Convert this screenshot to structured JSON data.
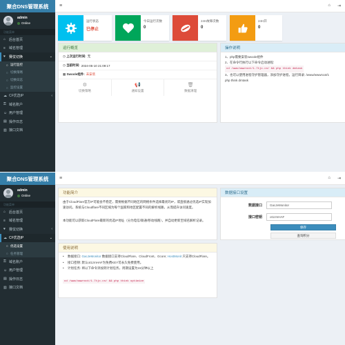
{
  "app": {
    "brand": "聚合DNS管理系统",
    "user": "admin",
    "status": "Online",
    "nav_header": "功能菜单"
  },
  "colors": {
    "sidebar": "#222d32",
    "brand": "#367fa9",
    "cyan": "#00c0ef",
    "green": "#00a65a",
    "red": "#dd4b39",
    "orange": "#f39c12"
  },
  "s1": {
    "menu": [
      {
        "label": "后台首页",
        "icon": "home-icon"
      },
      {
        "label": "域名管理",
        "icon": "list-icon"
      }
    ],
    "open_menu": "赛仗切换",
    "open_icon": "heart-icon",
    "sub": [
      "运行监控",
      "切换策略",
      "切换日志",
      "监控设置"
    ],
    "menu2": [
      {
        "label": "CF优选IP",
        "icon": "cloud-icon",
        "arrow": "‹"
      },
      {
        "label": "域名账户",
        "icon": "lock-icon"
      },
      {
        "label": "用户管理",
        "icon": "user-icon"
      },
      {
        "label": "操作日志",
        "icon": "file-icon"
      },
      {
        "label": "接口文档",
        "icon": "book-icon"
      }
    ],
    "cards": [
      {
        "title": "运行状态",
        "value": "已停止"
      },
      {
        "title": "今日运行次数",
        "value": "0"
      },
      {
        "title": "24H故障次数",
        "value": "0"
      },
      {
        "title": "24H开",
        "value": "0"
      }
    ],
    "overview": {
      "title": "运行概览",
      "last_run_label": "上次运行时间:",
      "last_run_value": "无",
      "now_label": "当前时间:",
      "now_value": "2024-05-10 21:09:17",
      "swoole_label": "Swoole组件:",
      "swoole_value": "未安装",
      "actions": [
        "切换策略",
        "通知设置",
        "数据清理"
      ]
    },
    "guide": {
      "title": "操作说明",
      "l1": "1、php需要安装swoole组件",
      "l2": "2、在命令行执行以下命令启动进程:",
      "cmd": "cd /www/wwwroot/1.7tjc.cn/ && php think dmtask",
      "l3": "3、也可以使用进程守护管理器，添加守护进程，运行目录: /www/wwwroot/1",
      "l4": "php think dmtask"
    }
  },
  "s2": {
    "menu": [
      {
        "label": "后台首页",
        "icon": "home-icon"
      },
      {
        "label": "域名管理",
        "icon": "list-icon"
      },
      {
        "label": "赛仗切换",
        "icon": "heart-icon",
        "arrow": "‹"
      }
    ],
    "open_menu": "CF优选IP",
    "open_icon": "cloud-icon",
    "sub": [
      "优选设置",
      "任务管理"
    ],
    "menu2": [
      {
        "label": "域名账户",
        "icon": "lock-icon"
      },
      {
        "label": "用户管理",
        "icon": "user-icon"
      },
      {
        "label": "操作日志",
        "icon": "file-icon"
      },
      {
        "label": "接口文档",
        "icon": "book-icon"
      }
    ],
    "intro": {
      "title": "功能简介",
      "p1": "由于CloudFlare官方IP可能会不稳定，需要根据不同地区的网络条件选择最优的IP，或直接通过优选IP实现加速访问。系统与Cloudflare不同区域为每个国家和地区配置不同的解析线路，从而提升访问速度。",
      "p2": "本功能可以获取CloudFlare最新的优选IP地址（分为电信/联通/移动线路），并自动更新至域名解析记录。"
    },
    "usage": {
      "title": "使用说明",
      "b1a": "数据接口: ",
      "b1b": "GacJeMonitor",
      "b1c": " 数据接口支持CloudFlare、CloudFront、Gcore; ",
      "b1d": "HostMonit",
      "b1e": " 只支持CloudFlare。",
      "b2": "接口密钥: 默认ot1zmHAF为免费KEY可永久免费使用。",
      "b3": "计划任务: 将以下命令添加到计划任务，周期设置为15分钟以上",
      "cmd": "cd /www/wwwroot/1.7tjc.cn/ && php think optimize"
    },
    "settings": {
      "title": "数据接口设置",
      "api_label": "数据接口",
      "api_value": "GacJeMonitor",
      "key_label": "接口密钥",
      "key_value": "ot1zmHAF",
      "save": "保存",
      "query": "查询积分"
    }
  }
}
